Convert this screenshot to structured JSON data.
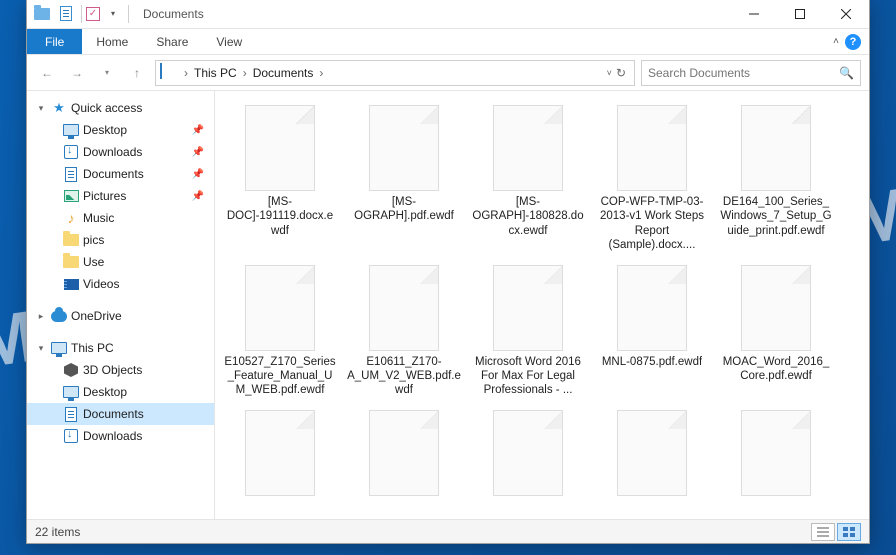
{
  "window": {
    "title": "Documents"
  },
  "ribbon": {
    "file": "File",
    "tabs": [
      "Home",
      "Share",
      "View"
    ]
  },
  "breadcrumb": {
    "items": [
      "This PC",
      "Documents"
    ]
  },
  "search": {
    "placeholder": "Search Documents"
  },
  "sidebar": {
    "quick_access": {
      "label": "Quick access"
    },
    "quick_items": [
      {
        "label": "Desktop",
        "icon": "monitor",
        "pinned": true
      },
      {
        "label": "Downloads",
        "icon": "download",
        "pinned": true
      },
      {
        "label": "Documents",
        "icon": "doc",
        "pinned": true
      },
      {
        "label": "Pictures",
        "icon": "pic",
        "pinned": true
      },
      {
        "label": "Music",
        "icon": "music",
        "pinned": false
      },
      {
        "label": "pics",
        "icon": "folder",
        "pinned": false
      },
      {
        "label": "Use",
        "icon": "folder",
        "pinned": false
      },
      {
        "label": "Videos",
        "icon": "video",
        "pinned": false
      }
    ],
    "onedrive": {
      "label": "OneDrive"
    },
    "thispc": {
      "label": "This PC"
    },
    "pc_items": [
      {
        "label": "3D Objects",
        "icon": "3d"
      },
      {
        "label": "Desktop",
        "icon": "monitor"
      },
      {
        "label": "Documents",
        "icon": "doc",
        "selected": true
      },
      {
        "label": "Downloads",
        "icon": "download"
      }
    ]
  },
  "files": [
    {
      "name": "[MS-DOC]-191119.docx.ewdf"
    },
    {
      "name": "[MS-OGRAPH].pdf.ewdf"
    },
    {
      "name": "[MS-OGRAPH]-180828.docx.ewdf"
    },
    {
      "name": "COP-WFP-TMP-03-2013-v1 Work Steps Report (Sample).docx...."
    },
    {
      "name": "DE164_100_Series_Windows_7_Setup_Guide_print.pdf.ewdf"
    },
    {
      "name": "E10527_Z170_Series_Feature_Manual_UM_WEB.pdf.ewdf"
    },
    {
      "name": "E10611_Z170-A_UM_V2_WEB.pdf.ewdf"
    },
    {
      "name": "Microsoft Word 2016 For Max For Legal Professionals - ..."
    },
    {
      "name": "MNL-0875.pdf.ewdf"
    },
    {
      "name": "MOAC_Word_2016_Core.pdf.ewdf"
    },
    {
      "name": ""
    },
    {
      "name": ""
    },
    {
      "name": ""
    },
    {
      "name": ""
    },
    {
      "name": ""
    }
  ],
  "status": {
    "count_label": "22 items"
  }
}
